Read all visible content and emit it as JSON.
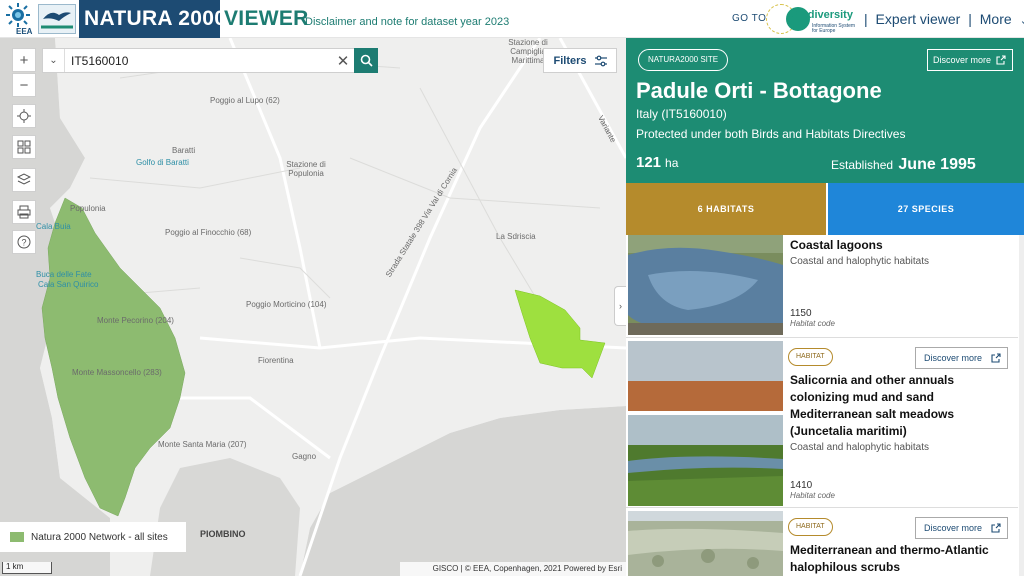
{
  "header": {
    "eea_label": "EEA",
    "natura_logo_text": "NATURA 2000",
    "brand": "NATURA 2000",
    "viewer": "VIEWER",
    "disclaimer": "Disclaimer and note for dataset year 2023",
    "goto": "GO TO",
    "biodiversity_logo": "Biodiversity",
    "biodiversity_sub": "Information System for Europe",
    "expert_viewer": "Expert viewer",
    "more": "More",
    "separator": "|"
  },
  "map": {
    "search": {
      "value": "IT5160010",
      "placeholder": ""
    },
    "filters_label": "Filters",
    "labels": {
      "pozzolungo": "Poggio al Lupo (62)",
      "campiglia": "Stazione di Campiglia Marittima",
      "golfo": "Golfo di Baratti",
      "baratti": "Baratti",
      "stazione_pop": "Stazione di Populonia",
      "populonia": "Populonia",
      "finocchio": "Poggio al Finocchio (68)",
      "cala_buia": "Cala Buia",
      "sdriscia": "La Sdriscia",
      "buca": "Buca delle Fate",
      "cala_quirico": "Cala San Quirico",
      "morticino": "Poggio Morticino (104)",
      "pecorino": "Monte Pecorino (204)",
      "massoncello": "Monte Massoncello (283)",
      "fiorentina": "Fiorentina",
      "santa_maria": "Monte Santa Maria (207)",
      "gagno": "Gagno",
      "piombino": "PIOMBINO",
      "strada": "Strada Statale 398 Via Val di Cornia",
      "variante": "Variante"
    },
    "legend_label": "Natura 2000 Network - all sites",
    "scale_label": "1 km",
    "attribution": "GISCO | © EEA, Copenhagen, 2021    Powered by Esri",
    "colors": {
      "network": "#8dbb70",
      "selected_site": "#9ee03f",
      "sea": "#d4d4d2"
    }
  },
  "panel": {
    "site_badge": "NATURA2000 SITE",
    "discover_more": "Discover more",
    "site_name": "Padule Orti - Bottagone",
    "country": "Italy (IT5160010)",
    "protection": "Protected under both Birds and Habitats Directives",
    "area_value": "121",
    "area_unit": "ha",
    "established_label": "Established",
    "established_date": "June 1995",
    "tab_habitats": "6 HABITATS",
    "tab_species": "27 SPECIES",
    "colors": {
      "header": "#1d8c73",
      "habitats_tab": "#b58b2c",
      "species_tab": "#1f86d9"
    },
    "habitats": [
      {
        "title": "Coastal lagoons",
        "category": "Coastal and halophytic habitats",
        "code": "1150",
        "code_label": "Habitat code"
      },
      {
        "badge": "HABITAT",
        "discover": "Discover more",
        "title": "Salicornia and other annuals colonizing mud and sand Mediterranean salt meadows (Juncetalia maritimi)",
        "category": "Coastal and halophytic habitats",
        "code": "1410",
        "code_label": "Habitat code"
      },
      {
        "badge": "HABITAT",
        "discover": "Discover more",
        "title": "Mediterranean and thermo-Atlantic halophilous scrubs (Sarcocornetea"
      }
    ]
  }
}
